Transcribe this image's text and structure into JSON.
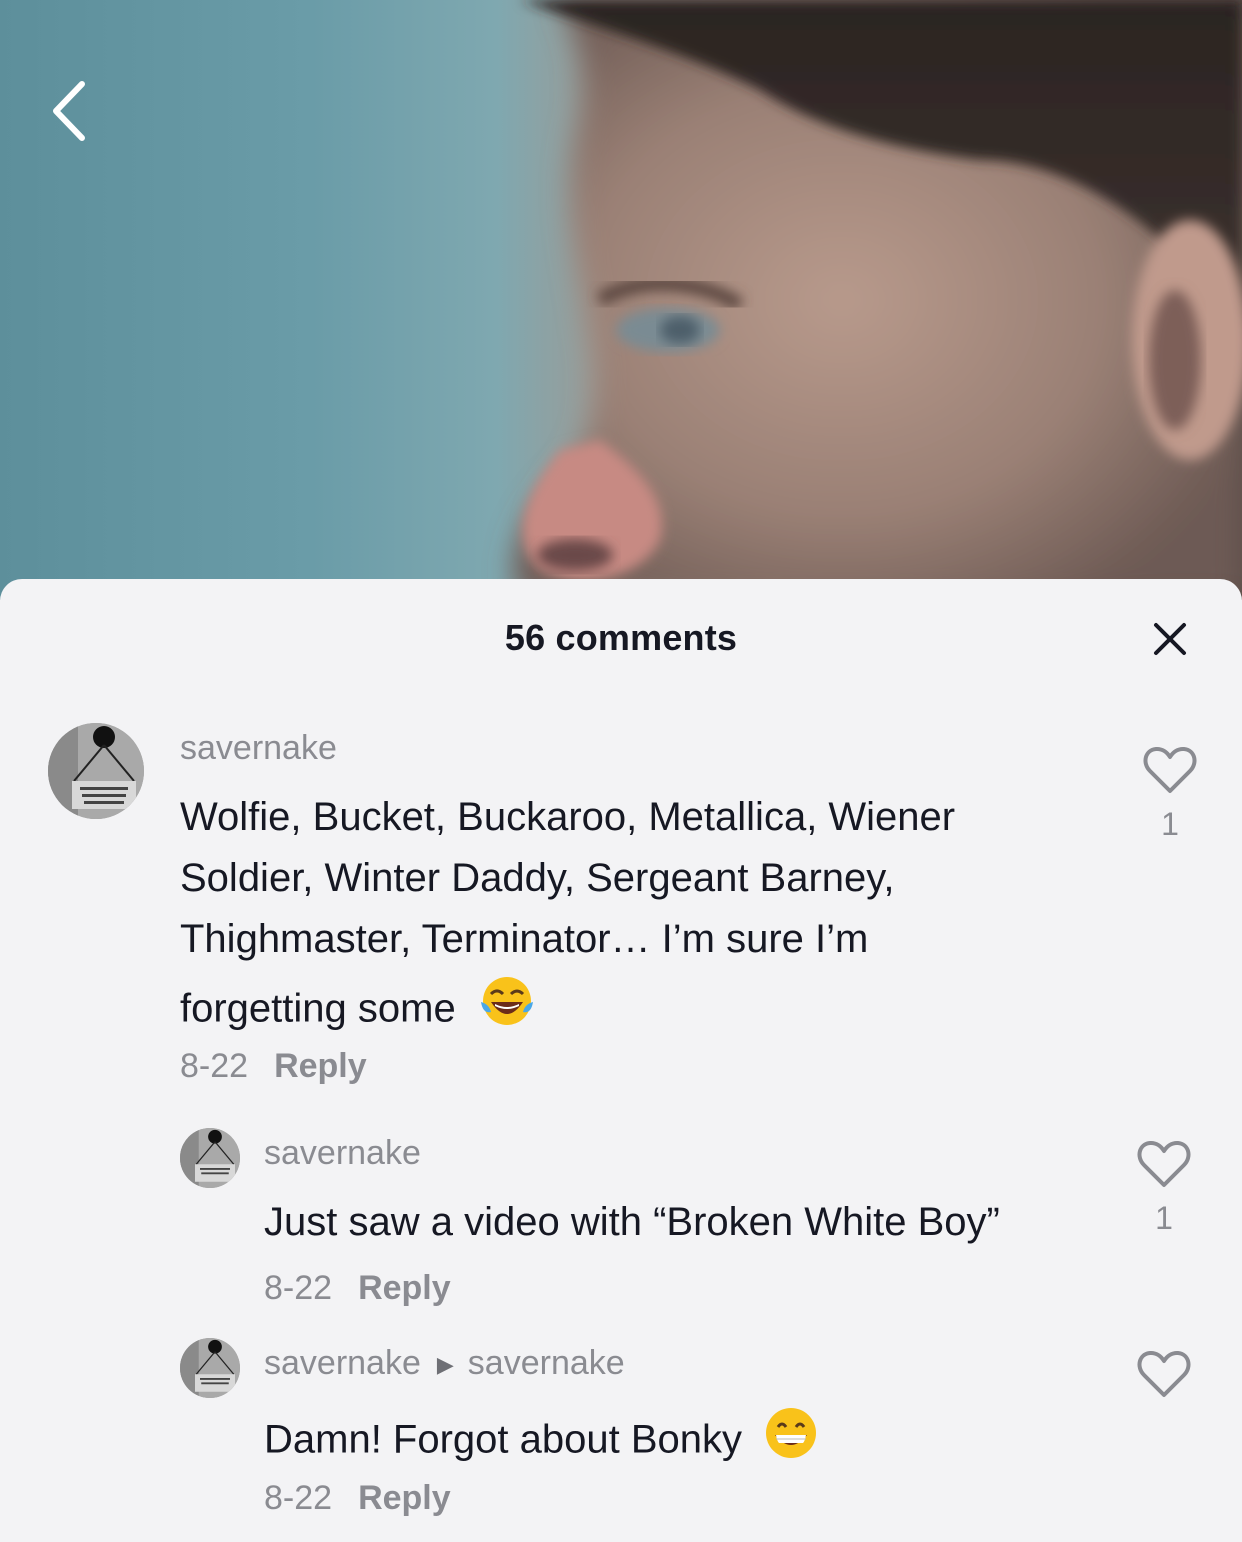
{
  "colors": {
    "sheet_background": "#f3f3f5",
    "primary_text": "#161823",
    "secondary_text": "#8a8b91"
  },
  "icons": {
    "back": "chevron-left-icon",
    "close": "close-icon",
    "like": "heart-outline-icon"
  },
  "header": {
    "title": "56 comments"
  },
  "comments": [
    {
      "username": "savernake",
      "text_lines": [
        "Wolfie, Bucket, Buckaroo, Metallica, Wiener",
        "Soldier, Winter Daddy, Sergeant Barney,",
        "Thighmaster, Terminator… I’m sure I’m",
        "forgetting some"
      ],
      "emoji": "😂",
      "date": "8-22",
      "reply_label": "Reply",
      "likes": "1"
    },
    {
      "username": "savernake",
      "text": "Just saw a video with “Broken White Boy”",
      "date": "8-22",
      "reply_label": "Reply",
      "likes": "1"
    },
    {
      "username": "savernake",
      "reply_to": "savernake",
      "text": "Damn! Forgot about Bonky",
      "emoji": "😁",
      "date": "8-22",
      "reply_label": "Reply",
      "likes": ""
    }
  ]
}
